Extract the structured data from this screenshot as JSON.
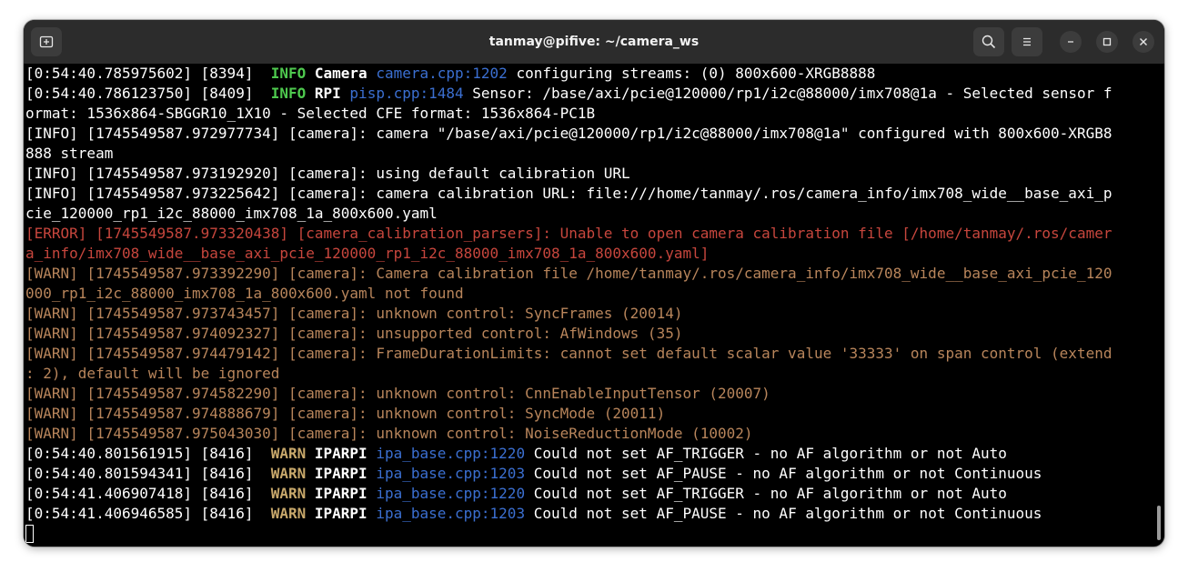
{
  "window": {
    "title": "tanmay@pifive: ~/camera_ws",
    "icons": {
      "new_tab": "new-tab-icon",
      "search": "search-icon",
      "menu": "hamburger-menu-icon",
      "minimize": "minimize-icon",
      "maximize": "maximize-icon",
      "close": "close-icon"
    }
  },
  "colors": {
    "info": "#4ec94e",
    "warn_tag": "#c8a86b",
    "file_ref": "#3b6fd1",
    "error": "#c7463d",
    "warn": "#b8855b",
    "background": "#000000",
    "titlebar": "#2c2c2c"
  },
  "terminal": {
    "lines": [
      {
        "a": "[0:54:40.785975602] [8394]  ",
        "tag": "INFO",
        "mod": " Camera ",
        "file": "camera.cpp:1202",
        "msg": " configuring streams: (0) 800x600-XRGB8888"
      },
      {
        "a": "[0:54:40.786123750] [8409]  ",
        "tag": "INFO",
        "mod": " RPI ",
        "file": "pisp.cpp:1484",
        "msg": " Sensor: /base/axi/pcie@120000/rp1/i2c@88000/imx708@1a - Selected sensor f"
      },
      {
        "text": "ormat: 1536x864-SBGGR10_1X10 - Selected CFE format: 1536x864-PC1B"
      },
      {
        "text": "[INFO] [1745549587.972977734] [camera]: camera \"/base/axi/pcie@120000/rp1/i2c@88000/imx708@1a\" configured with 800x600-XRGB8"
      },
      {
        "text": "888 stream"
      },
      {
        "text": "[INFO] [1745549587.973192920] [camera]: using default calibration URL"
      },
      {
        "text": "[INFO] [1745549587.973225642] [camera]: camera calibration URL: file:///home/tanmay/.ros/camera_info/imx708_wide__base_axi_p"
      },
      {
        "text": "cie_120000_rp1_i2c_88000_imx708_1a_800x600.yaml"
      },
      {
        "text": "[ERROR] [1745549587.973320438] [camera_calibration_parsers]: Unable to open camera calibration file [/home/tanmay/.ros/camer",
        "level": "error"
      },
      {
        "text": "a_info/imx708_wide__base_axi_pcie_120000_rp1_i2c_88000_imx708_1a_800x600.yaml]",
        "level": "error"
      },
      {
        "text": "[WARN] [1745549587.973392290] [camera]: Camera calibration file /home/tanmay/.ros/camera_info/imx708_wide__base_axi_pcie_120",
        "level": "warn"
      },
      {
        "text": "000_rp1_i2c_88000_imx708_1a_800x600.yaml not found",
        "level": "warn"
      },
      {
        "text": "[WARN] [1745549587.973743457] [camera]: unknown control: SyncFrames (20014)",
        "level": "warn"
      },
      {
        "text": "[WARN] [1745549587.974092327] [camera]: unsupported control: AfWindows (35)",
        "level": "warn"
      },
      {
        "text": "[WARN] [1745549587.974479142] [camera]: FrameDurationLimits: cannot set default scalar value '33333' on span control (extend",
        "level": "warn"
      },
      {
        "text": ": 2), default will be ignored",
        "level": "warn"
      },
      {
        "text": "[WARN] [1745549587.974582290] [camera]: unknown control: CnnEnableInputTensor (20007)",
        "level": "warn"
      },
      {
        "text": "[WARN] [1745549587.974888679] [camera]: unknown control: SyncMode (20011)",
        "level": "warn"
      },
      {
        "text": "[WARN] [1745549587.975043030] [camera]: unknown control: NoiseReductionMode (10002)",
        "level": "warn"
      },
      {
        "a": "[0:54:40.801561915] [8416]  ",
        "tag": "WARN",
        "mod": " IPARPI ",
        "file": "ipa_base.cpp:1220",
        "msg": " Could not set AF_TRIGGER - no AF algorithm or not Auto"
      },
      {
        "a": "[0:54:40.801594341] [8416]  ",
        "tag": "WARN",
        "mod": " IPARPI ",
        "file": "ipa_base.cpp:1203",
        "msg": " Could not set AF_PAUSE - no AF algorithm or not Continuous"
      },
      {
        "a": "[0:54:41.406907418] [8416]  ",
        "tag": "WARN",
        "mod": " IPARPI ",
        "file": "ipa_base.cpp:1220",
        "msg": " Could not set AF_TRIGGER - no AF algorithm or not Auto"
      },
      {
        "a": "[0:54:41.406946585] [8416]  ",
        "tag": "WARN",
        "mod": " IPARPI ",
        "file": "ipa_base.cpp:1203",
        "msg": " Could not set AF_PAUSE - no AF algorithm or not Continuous"
      }
    ]
  }
}
